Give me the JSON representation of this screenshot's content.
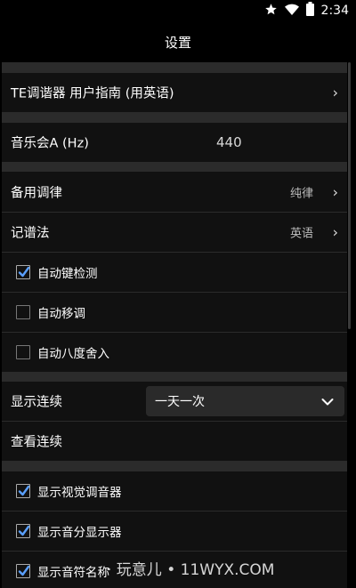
{
  "status": {
    "time": "2:34",
    "icons": [
      "star-icon",
      "wifi-icon",
      "battery-icon"
    ]
  },
  "title": "设置",
  "rows": {
    "guide": {
      "label": "TE调谐器 用户指南 (用英语)",
      "chevron": "›"
    },
    "concert_a": {
      "label": "音乐会A (Hz)",
      "value": "440"
    },
    "alt_tuning": {
      "label": "备用调律",
      "value": "纯律",
      "chevron": "›"
    },
    "notation": {
      "label": "记谱法",
      "value": "英语",
      "chevron": "›"
    },
    "auto_key": {
      "label": "自动键检测",
      "checked": true
    },
    "auto_transpose": {
      "label": "自动移调",
      "checked": false
    },
    "auto_octave": {
      "label": "自动八度舍入",
      "checked": false
    },
    "show_continuous": {
      "label": "显示连续",
      "dropdown": "一天一次"
    },
    "view_continuous": {
      "label": "查看连续"
    },
    "show_visual_tuner": {
      "label": "显示视觉调音器",
      "checked": true
    },
    "show_cents": {
      "label": "显示音分显示器",
      "checked": true
    },
    "show_note_names": {
      "label": "显示音符名称",
      "checked": true
    }
  },
  "watermark": "· 玩意儿 • 11WYX.COM",
  "colors": {
    "background": "#000000",
    "row": "#111111",
    "separator": "#2b2b2b",
    "text": "#ffffff",
    "secondary_text": "#bdbdbd"
  }
}
